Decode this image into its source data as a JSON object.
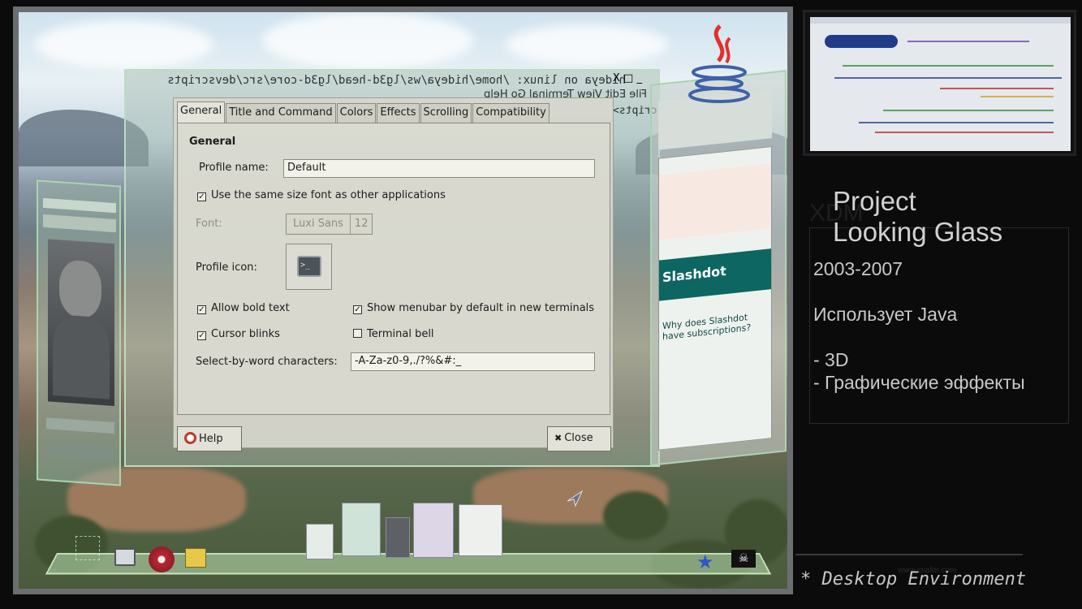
{
  "screenshot": {
    "back_window_title": "hideya on linux: /home/hideya/ws/lg3d-head/lg3d-core/src/devscripts",
    "back_window_menu": "File   Edit   View   Terminal   Go   Help",
    "back_window_controls": "_ □ X",
    "back_window_path": "src/devscripts>",
    "right_window_banner": "Slashdot",
    "right_window_question": "Why does Slashdot have subscriptions?",
    "dialog": {
      "tabs": [
        "General",
        "Title and Command",
        "Colors",
        "Effects",
        "Scrolling",
        "Compatibility"
      ],
      "section_title": "General",
      "profile_name_label": "Profile name:",
      "profile_name_value": "Default",
      "same_font_label": "Use the same size font as other applications",
      "font_label": "Font:",
      "font_name": "Luxi Sans",
      "font_size": "12",
      "profile_icon_label": "Profile icon:",
      "profile_icon_glyph": ">_",
      "allow_bold_label": "Allow bold text",
      "show_menubar_label": "Show menubar by default in new terminals",
      "cursor_blinks_label": "Cursor blinks",
      "terminal_bell_label": "Terminal bell",
      "select_word_label": "Select-by-word characters:",
      "select_word_value": "-A-Za-z0-9,./?%&#:_",
      "help_label": "Help",
      "close_label": "Close",
      "close_glyph": "✖"
    }
  },
  "slide": {
    "ghost_label": "XDM",
    "title_line1": "Project",
    "title_line2": "Looking Glass",
    "years": "2003-2007",
    "uses": "Использует Java",
    "bullet1": "- 3D",
    "bullet2": "- Графические эффекты",
    "website": "www.ssafer.com",
    "footer": "* Desktop Environment"
  }
}
